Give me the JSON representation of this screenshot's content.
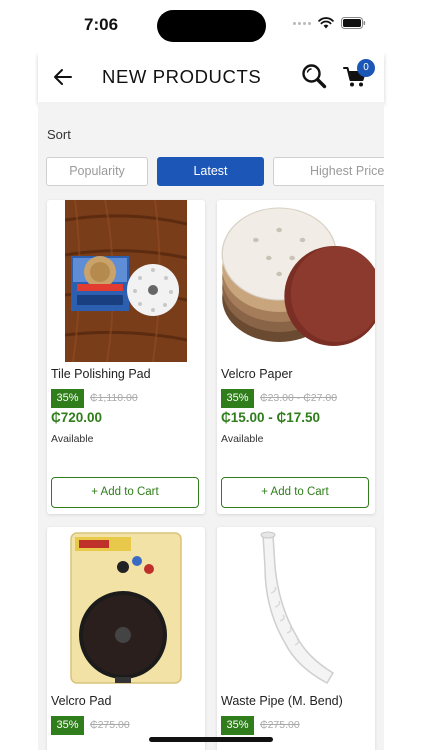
{
  "status_bar": {
    "time": "7:06"
  },
  "header": {
    "title": "NEW PRODUCTS",
    "cart_count": "0",
    "back_icon": "arrow-left-icon",
    "search_icon": "search-icon",
    "cart_icon": "shopping-cart-icon"
  },
  "sort": {
    "label": "Sort",
    "options": [
      "Popularity",
      "Latest",
      "Highest Price"
    ],
    "selected": "Latest"
  },
  "colors": {
    "accent": "#1c57b7",
    "price_green": "#2f7d1b"
  },
  "products": [
    {
      "name": "Tile Polishing Pad",
      "discount": "35%",
      "old_price": "₵1,110.00",
      "price": "₵720.00",
      "availability": "Available",
      "button": "+ Add to Cart"
    },
    {
      "name": "Velcro Paper",
      "discount": "35%",
      "old_price": "₵23.00 - ₵27.00",
      "price": "₵15.00 - ₵17.50",
      "availability": "Available",
      "button": "+ Add to Cart"
    },
    {
      "name": "Velcro Pad",
      "discount": "35%",
      "old_price": "₵275.00"
    },
    {
      "name": "Waste Pipe (M. Bend)",
      "discount": "35%",
      "old_price": "₵275.00"
    }
  ]
}
